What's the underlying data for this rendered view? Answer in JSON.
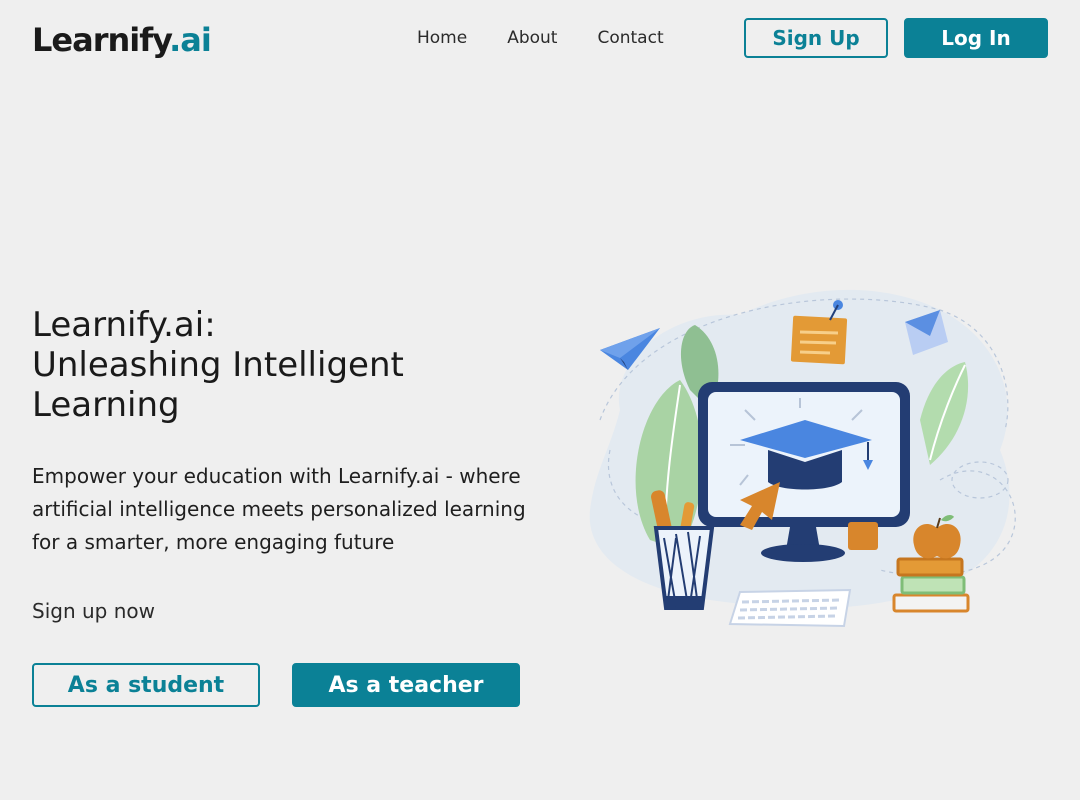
{
  "header": {
    "logo_main": "Learnify",
    "logo_accent": ".ai",
    "nav": [
      "Home",
      "About",
      "Contact"
    ],
    "signup_label": "Sign Up",
    "login_label": "Log In"
  },
  "hero": {
    "title_lines": [
      "Learnify.ai:",
      "Unleashing Intelligent",
      "Learning"
    ],
    "description": "Empower your education with Learnify.ai - where artificial intelligence meets personalized learning for a smarter, more engaging future",
    "cta_label": "Sign up now",
    "student_button": "As a student",
    "teacher_button": "As a teacher"
  },
  "colors": {
    "accent": "#0b8196",
    "background": "#efefef"
  },
  "illustration": {
    "icons": [
      "paper-plane-icon",
      "sticky-note-icon",
      "envelope-icon",
      "monitor-icon",
      "graduation-cap-icon",
      "cursor-arrow-icon",
      "pencil-cup-icon",
      "keyboard-icon",
      "apple-icon",
      "books-icon",
      "leaf-icon"
    ]
  }
}
